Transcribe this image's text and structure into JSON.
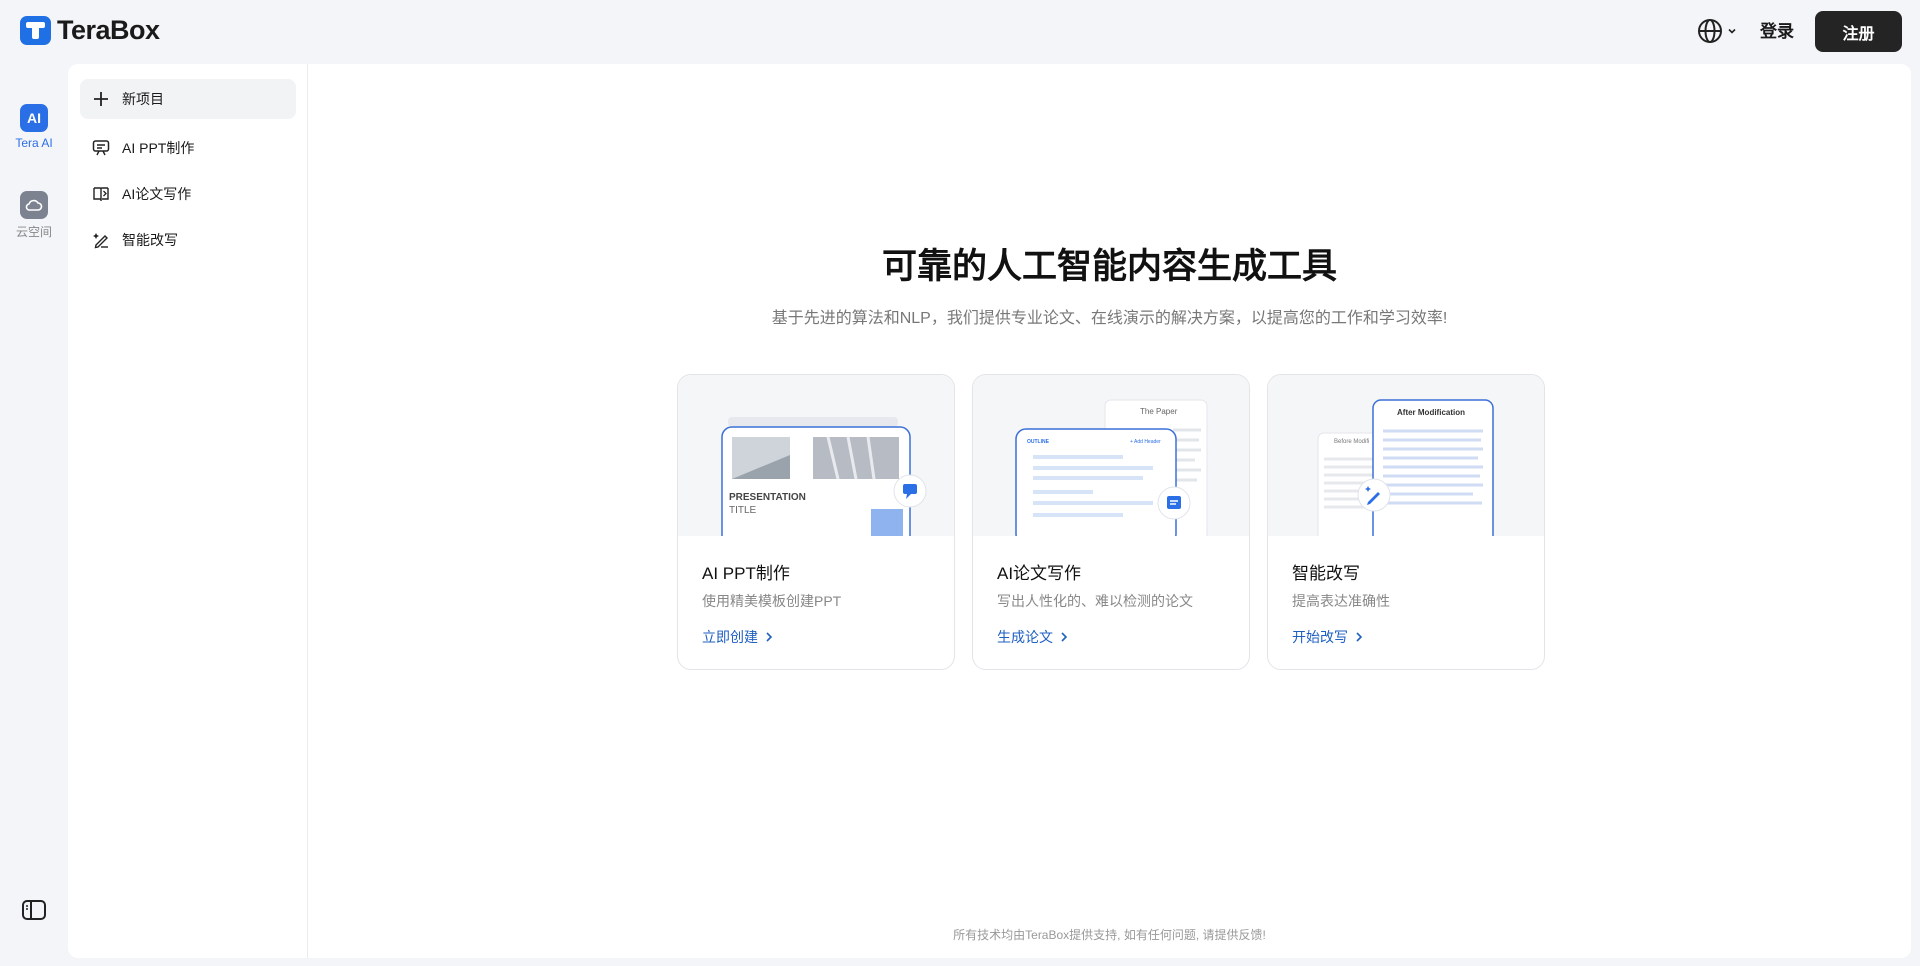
{
  "app": {
    "logo_text": "TeraBox"
  },
  "header": {
    "language_icon": "globe-icon",
    "login_label": "登录",
    "register_label": "注册"
  },
  "rail": {
    "items": [
      {
        "label": "Tera AI",
        "icon": "ai-icon",
        "icon_text": "AI",
        "active": true
      },
      {
        "label": "云空间",
        "icon": "cloud-icon",
        "active": false
      }
    ]
  },
  "sidebar": {
    "items": [
      {
        "label": "新项目",
        "icon": "plus-icon",
        "active": true
      },
      {
        "label": "AI PPT制作",
        "icon": "presentation-icon"
      },
      {
        "label": "AI论文写作",
        "icon": "book-icon"
      },
      {
        "label": "智能改写",
        "icon": "rewrite-icon"
      }
    ]
  },
  "hero": {
    "title": "可靠的人工智能内容生成工具",
    "subtitle": "基于先进的算法和NLP，我们提供专业论文、在线演示的解决方案，以提高您的工作和学习效率!"
  },
  "cards": [
    {
      "title": "AI PPT制作",
      "desc": "使用精美模板创建PPT",
      "link": "立即创建",
      "preview": {
        "line1": "PRESENTATION",
        "line2": "TITLE"
      }
    },
    {
      "title": "AI论文写作",
      "desc": "写出人性化的、难以检测的论文",
      "link": "生成论文",
      "preview": {
        "paper_label": "The Paper",
        "outline_label": "OUTLINE",
        "add_label": "+ Add Header"
      }
    },
    {
      "title": "智能改写",
      "desc": "提高表达准确性",
      "link": "开始改写",
      "preview": {
        "after_label": "After Modification",
        "before_label": "Before Modifi"
      }
    }
  ],
  "footer": {
    "text": "所有技术均由TeraBox提供支持, 如有任何问题, 请提供反馈!"
  },
  "colors": {
    "accent": "#2b6fe6",
    "link": "#1e5fc2",
    "register_bg": "#242424"
  }
}
